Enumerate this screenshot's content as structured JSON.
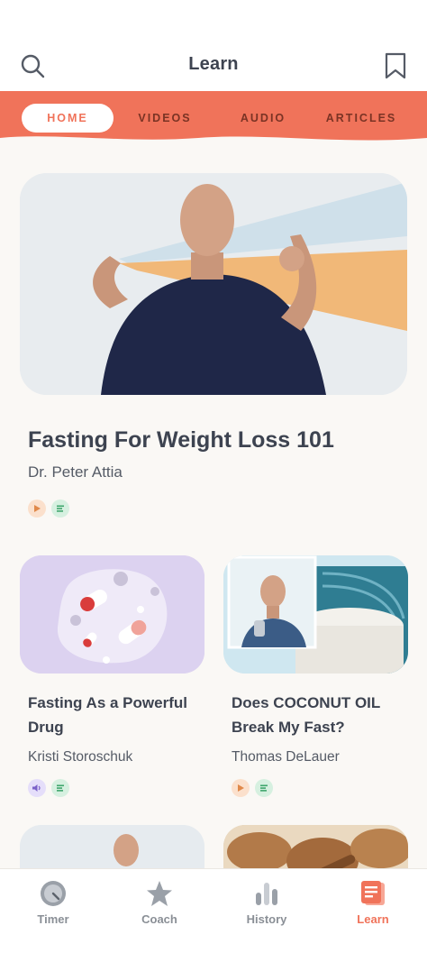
{
  "header": {
    "title": "Learn",
    "search_icon": "search-icon",
    "bookmark_icon": "bookmark-icon"
  },
  "tabs": [
    {
      "label": "HOME",
      "active": true
    },
    {
      "label": "VIDEOS",
      "active": false
    },
    {
      "label": "AUDIO",
      "active": false
    },
    {
      "label": "ARTICLES",
      "active": false
    }
  ],
  "featured": {
    "title": "Fasting For Weight Loss 101",
    "author": "Dr. Peter Attia",
    "badges": [
      "play-icon",
      "text-icon"
    ]
  },
  "cards": [
    {
      "title": "Fasting As a Powerful Drug",
      "author": "Kristi Storoschuk",
      "badges": [
        "audio-icon",
        "text-icon"
      ]
    },
    {
      "title": "Does COCONUT OIL Break My Fast?",
      "author": "Thomas DeLauer",
      "badges": [
        "play-icon",
        "text-icon"
      ]
    }
  ],
  "bottom_nav": [
    {
      "label": "Timer",
      "icon": "timer-icon",
      "active": false
    },
    {
      "label": "Coach",
      "icon": "star-icon",
      "active": false
    },
    {
      "label": "History",
      "icon": "bar-chart-icon",
      "active": false
    },
    {
      "label": "Learn",
      "icon": "learn-icon",
      "active": true
    }
  ],
  "colors": {
    "accent": "#f0735a",
    "tab_text": "#7a3324",
    "background": "#faf8f5"
  }
}
